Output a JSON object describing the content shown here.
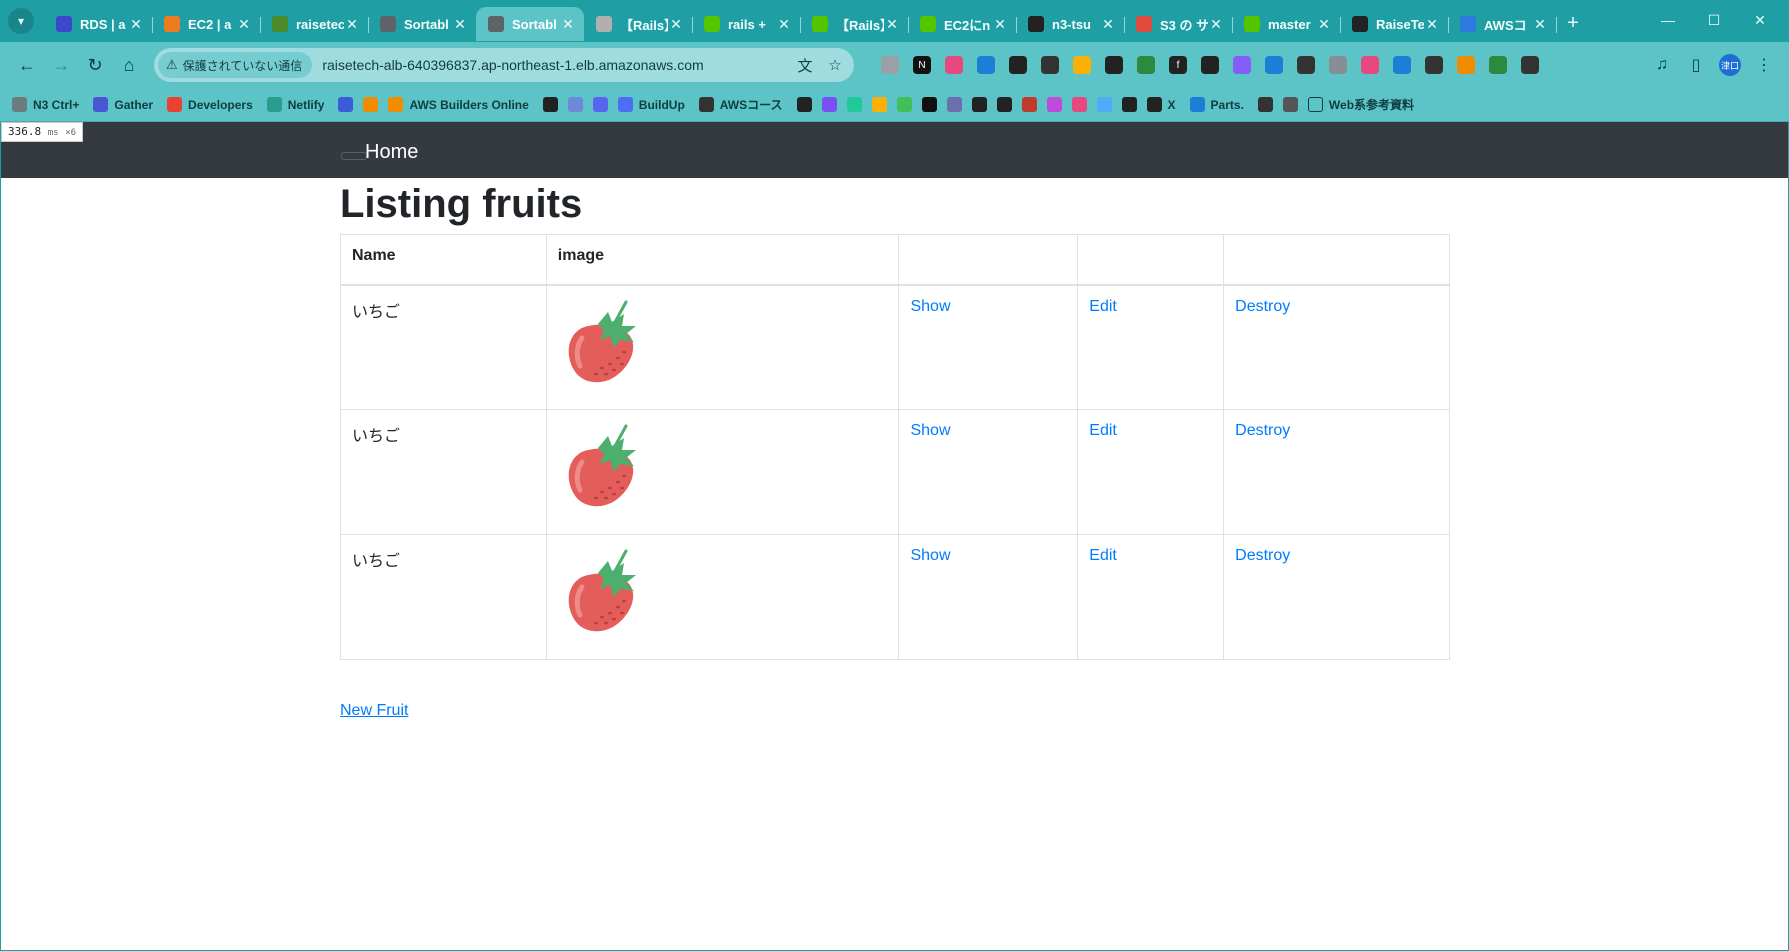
{
  "browser": {
    "tabs": [
      {
        "title": "RDS | a",
        "favicon_color": "#3b48cc",
        "active": false
      },
      {
        "title": "EC2 | a",
        "favicon_color": "#ed7d1f",
        "active": false
      },
      {
        "title": "raisetec",
        "favicon_color": "#4a8c2b",
        "active": false
      },
      {
        "title": "Sortabl",
        "favicon_color": "#5f6368",
        "active": false
      },
      {
        "title": "Sortabl",
        "favicon_color": "#5f6368",
        "active": true
      },
      {
        "title": "【Rails】",
        "favicon_color": "#b0b0b0",
        "active": false
      },
      {
        "title": "rails +",
        "favicon_color": "#55c500",
        "active": false
      },
      {
        "title": "【Rails】",
        "favicon_color": "#55c500",
        "active": false
      },
      {
        "title": "EC2にn",
        "favicon_color": "#55c500",
        "active": false
      },
      {
        "title": "n3-tsu",
        "favicon_color": "#222222",
        "active": false
      },
      {
        "title": "S3 の サ",
        "favicon_color": "#e04a3f",
        "active": false
      },
      {
        "title": "master",
        "favicon_color": "#55c500",
        "active": false
      },
      {
        "title": "RaiseTe",
        "favicon_color": "#222222",
        "active": false
      },
      {
        "title": "AWSコ",
        "favicon_color": "#2d7be0",
        "active": false
      }
    ],
    "new_tab_glyph": "+",
    "security_chip": "保護されていない通信",
    "url": "raisetech-alb-640396837.ap-northeast-1.elb.amazonaws.com",
    "profile_label": "津口",
    "bookmarks": [
      {
        "label": "N3 Ctrl+",
        "color": "#6b7c80"
      },
      {
        "label": "Gather",
        "color": "#4a55d6"
      },
      {
        "label": "Developers",
        "color": "#e94235"
      },
      {
        "label": "Netlify",
        "color": "#2a9d8f"
      },
      {
        "label": "",
        "color": "#3b5bdb"
      },
      {
        "label": "",
        "color": "#f08c00"
      },
      {
        "label": "AWS Builders Online",
        "color": "#f08c00"
      },
      {
        "label": "",
        "color": "#222222"
      },
      {
        "label": "",
        "color": "#6c8ad9"
      },
      {
        "label": "",
        "color": "#5865f2"
      },
      {
        "label": "BuildUp",
        "color": "#4c6ef5"
      },
      {
        "label": "AWSコース",
        "color": "#333333"
      },
      {
        "label": "",
        "color": "#222222"
      },
      {
        "label": "",
        "color": "#7950f2"
      },
      {
        "label": "",
        "color": "#20c997"
      },
      {
        "label": "",
        "color": "#fab005"
      },
      {
        "label": "",
        "color": "#40c057"
      },
      {
        "label": "",
        "color": "#111111"
      },
      {
        "label": "",
        "color": "#6c6fae"
      },
      {
        "label": "",
        "color": "#222222"
      },
      {
        "label": "",
        "color": "#222222"
      },
      {
        "label": "",
        "color": "#c0392b"
      },
      {
        "label": "",
        "color": "#be4bdb"
      },
      {
        "label": "",
        "color": "#e64980"
      },
      {
        "label": "",
        "color": "#4dabf7"
      },
      {
        "label": "",
        "color": "#222222"
      },
      {
        "label": "X",
        "color": "#222222"
      },
      {
        "label": "Parts.",
        "color": "#1c7ed6"
      },
      {
        "label": "",
        "color": "#333333"
      },
      {
        "label": "",
        "color": "#555555"
      },
      {
        "label": "Web系参考資料",
        "color": "#0f3d40"
      }
    ]
  },
  "timing": {
    "value": "336.8",
    "unit": "ms",
    "count": "×6"
  },
  "page": {
    "brand": "Home",
    "title": "Listing fruits",
    "table": {
      "headers": [
        "Name",
        "image",
        "",
        "",
        ""
      ],
      "rows": [
        {
          "name": "いちご",
          "show": "Show",
          "edit": "Edit",
          "destroy": "Destroy"
        },
        {
          "name": "いちご",
          "show": "Show",
          "edit": "Edit",
          "destroy": "Destroy"
        },
        {
          "name": "いちご",
          "show": "Show",
          "edit": "Edit",
          "destroy": "Destroy"
        }
      ]
    },
    "new_link": "New Fruit",
    "colors": {
      "navbar": "#343a40",
      "link": "#007bff",
      "chrome": "#1f9ea3",
      "strawberry": "#e35d5b",
      "leaf": "#4caf6e"
    }
  }
}
